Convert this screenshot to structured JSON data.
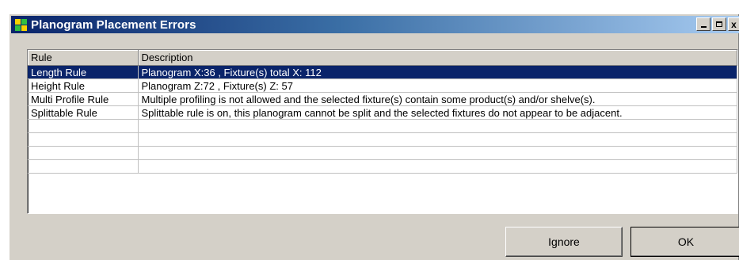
{
  "window": {
    "title": "Planogram Placement Errors",
    "caption_min": "_",
    "caption_close": "x"
  },
  "table": {
    "columns": [
      "Rule",
      "Description"
    ],
    "rows": [
      {
        "rule": "Length Rule",
        "description": "Planogram X:36 , Fixture(s) total X: 112",
        "selected": true
      },
      {
        "rule": "Height Rule",
        "description": "Planogram Z:72 , Fixture(s) Z: 57",
        "selected": false
      },
      {
        "rule": "Multi Profile Rule",
        "description": "Multiple profiling is not allowed and the selected fixture(s) contain some product(s) and/or shelve(s).",
        "selected": false
      },
      {
        "rule": "Splittable Rule",
        "description": "Splittable rule is on, this planogram cannot be split and the selected fixtures do not appear to be adjacent.",
        "selected": false
      },
      {
        "rule": "",
        "description": "",
        "selected": false
      },
      {
        "rule": "",
        "description": "",
        "selected": false
      },
      {
        "rule": "",
        "description": "",
        "selected": false
      },
      {
        "rule": "",
        "description": "",
        "selected": false
      }
    ]
  },
  "buttons": {
    "ignore": "Ignore",
    "ok": "OK"
  },
  "colors": {
    "selection": "#0a246a",
    "face": "#d4d0c8"
  }
}
